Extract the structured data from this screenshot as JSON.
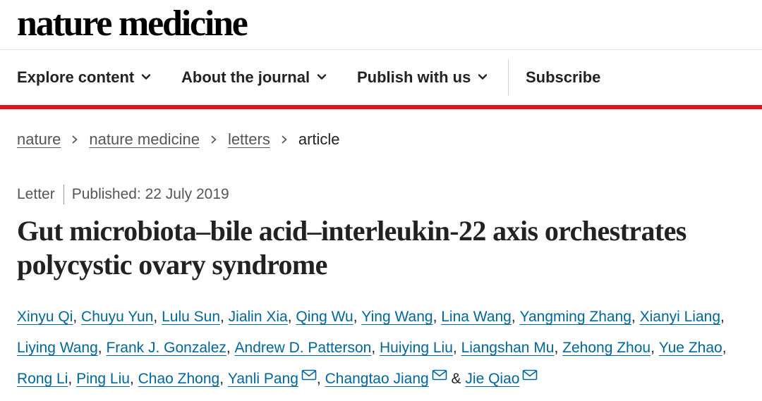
{
  "brand": {
    "logo_text": "nature medicine"
  },
  "nav": {
    "items": [
      {
        "label": "Explore content",
        "has_dropdown": true
      },
      {
        "label": "About the journal",
        "has_dropdown": true
      },
      {
        "label": "Publish with us",
        "has_dropdown": true
      },
      {
        "label": "Subscribe",
        "has_dropdown": false
      }
    ]
  },
  "breadcrumb": {
    "items": [
      {
        "label": "nature",
        "link": true
      },
      {
        "label": "nature medicine",
        "link": true
      },
      {
        "label": "letters",
        "link": true
      },
      {
        "label": "article",
        "link": false
      }
    ]
  },
  "article": {
    "type": "Letter",
    "published": "Published: 22 July 2019",
    "title": "Gut microbiota–bile acid–interleukin-22 axis orchestrates polycystic ovary syndrome"
  },
  "authors": {
    "list": [
      {
        "name": "Xinyu Qi",
        "sep": ", "
      },
      {
        "name": "Chuyu Yun",
        "sep": ", "
      },
      {
        "name": "Lulu Sun",
        "sep": ", "
      },
      {
        "name": "Jialin Xia",
        "sep": ", "
      },
      {
        "name": "Qing Wu",
        "sep": ", "
      },
      {
        "name": "Ying Wang",
        "sep": ", "
      },
      {
        "name": "Lina Wang",
        "sep": ", "
      },
      {
        "name": "Yangming Zhang",
        "sep": ", "
      },
      {
        "name": "Xianyi Liang",
        "sep": ", "
      },
      {
        "name": "Liying Wang",
        "sep": ", "
      },
      {
        "name": "Frank J. Gonzalez",
        "sep": ", "
      },
      {
        "name": "Andrew D. Patterson",
        "sep": ", "
      },
      {
        "name": "Huiying Liu",
        "sep": ", "
      },
      {
        "name": "Liangshan Mu",
        "sep": ", "
      },
      {
        "name": "Zehong Zhou",
        "sep": ", "
      },
      {
        "name": "Yue Zhao",
        "sep": ", "
      },
      {
        "name": "Rong Li",
        "sep": ", "
      },
      {
        "name": "Ping Liu",
        "sep": ", "
      },
      {
        "name": "Chao Zhong",
        "sep": ", "
      },
      {
        "name": "Yanli Pang",
        "sep": ", ",
        "corresponding": true
      },
      {
        "name": "Changtao Jiang",
        "sep": " & ",
        "corresponding": true
      },
      {
        "name": "Jie Qiao",
        "sep": "",
        "corresponding": true
      }
    ]
  },
  "icons": {
    "dropdown": "chevron-down-icon",
    "breadcrumb_separator": "chevron-right-icon",
    "corresponding": "envelope-icon"
  },
  "colors": {
    "accent_red": "#e0131b",
    "link_blue": "#006699",
    "text": "#222222",
    "muted": "#555555"
  }
}
